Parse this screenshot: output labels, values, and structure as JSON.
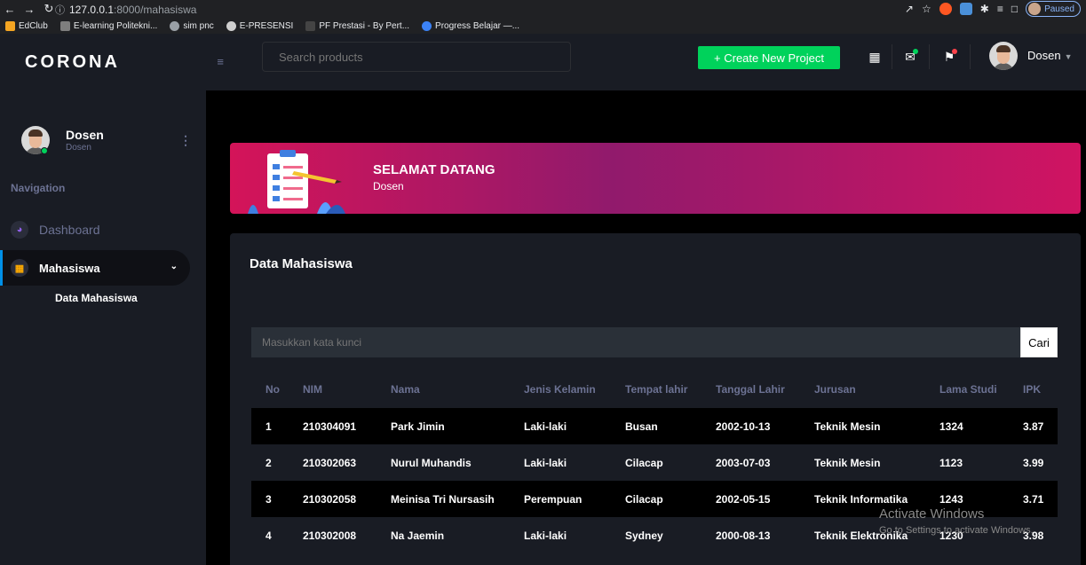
{
  "browser": {
    "url_host": "127.0.0.1",
    "url_path": ":8000/mahasiswa",
    "paused_label": "Paused",
    "bookmarks": [
      "EdClub",
      "E-learning Politekni...",
      "sim pnc",
      "E-PRESENSI",
      "PF Prestasi - By Pert...",
      "Progress Belajar —..."
    ]
  },
  "brand": "CORONA",
  "profile": {
    "name": "Dosen",
    "role": "Dosen"
  },
  "sidebar": {
    "caption": "Navigation",
    "dashboard": "Dashboard",
    "mahasiswa": "Mahasiswa",
    "sub_item": "Data Mahasiswa"
  },
  "navbar": {
    "search_placeholder": "Search products",
    "create_label": "+ Create New Project",
    "user_name": "Dosen"
  },
  "welcome": {
    "title": "SELAMAT DATANG",
    "subtitle": "Dosen"
  },
  "card": {
    "title": "Data Mahasiswa",
    "keyword_placeholder": "Masukkan kata kunci",
    "search_button": "Cari"
  },
  "table": {
    "headers": [
      "No",
      "NIM",
      "Nama",
      "Jenis Kelamin",
      "Tempat lahir",
      "Tanggal Lahir",
      "Jurusan",
      "Lama Studi",
      "IPK"
    ],
    "rows": [
      [
        "1",
        "210304091",
        "Park Jimin",
        "Laki-laki",
        "Busan",
        "2002-10-13",
        "Teknik Mesin",
        "1324",
        "3.87"
      ],
      [
        "2",
        "210302063",
        "Nurul Muhandis",
        "Laki-laki",
        "Cilacap",
        "2003-07-03",
        "Teknik Mesin",
        "1123",
        "3.99"
      ],
      [
        "3",
        "210302058",
        "Meinisa Tri Nursasih",
        "Perempuan",
        "Cilacap",
        "2002-05-15",
        "Teknik Informatika",
        "1243",
        "3.71"
      ],
      [
        "4",
        "210302008",
        "Na Jaemin",
        "Laki-laki",
        "Sydney",
        "2000-08-13",
        "Teknik Elektronika",
        "1230",
        "3.98"
      ]
    ]
  },
  "watermark": {
    "line1": "Activate Windows",
    "line2": "Go to Settings to activate Windows."
  },
  "colors": {
    "accent_green": "#00d25b",
    "accent_blue": "#0090e7",
    "banner_pink": "#d41459",
    "sidebar_bg": "#191c24"
  }
}
